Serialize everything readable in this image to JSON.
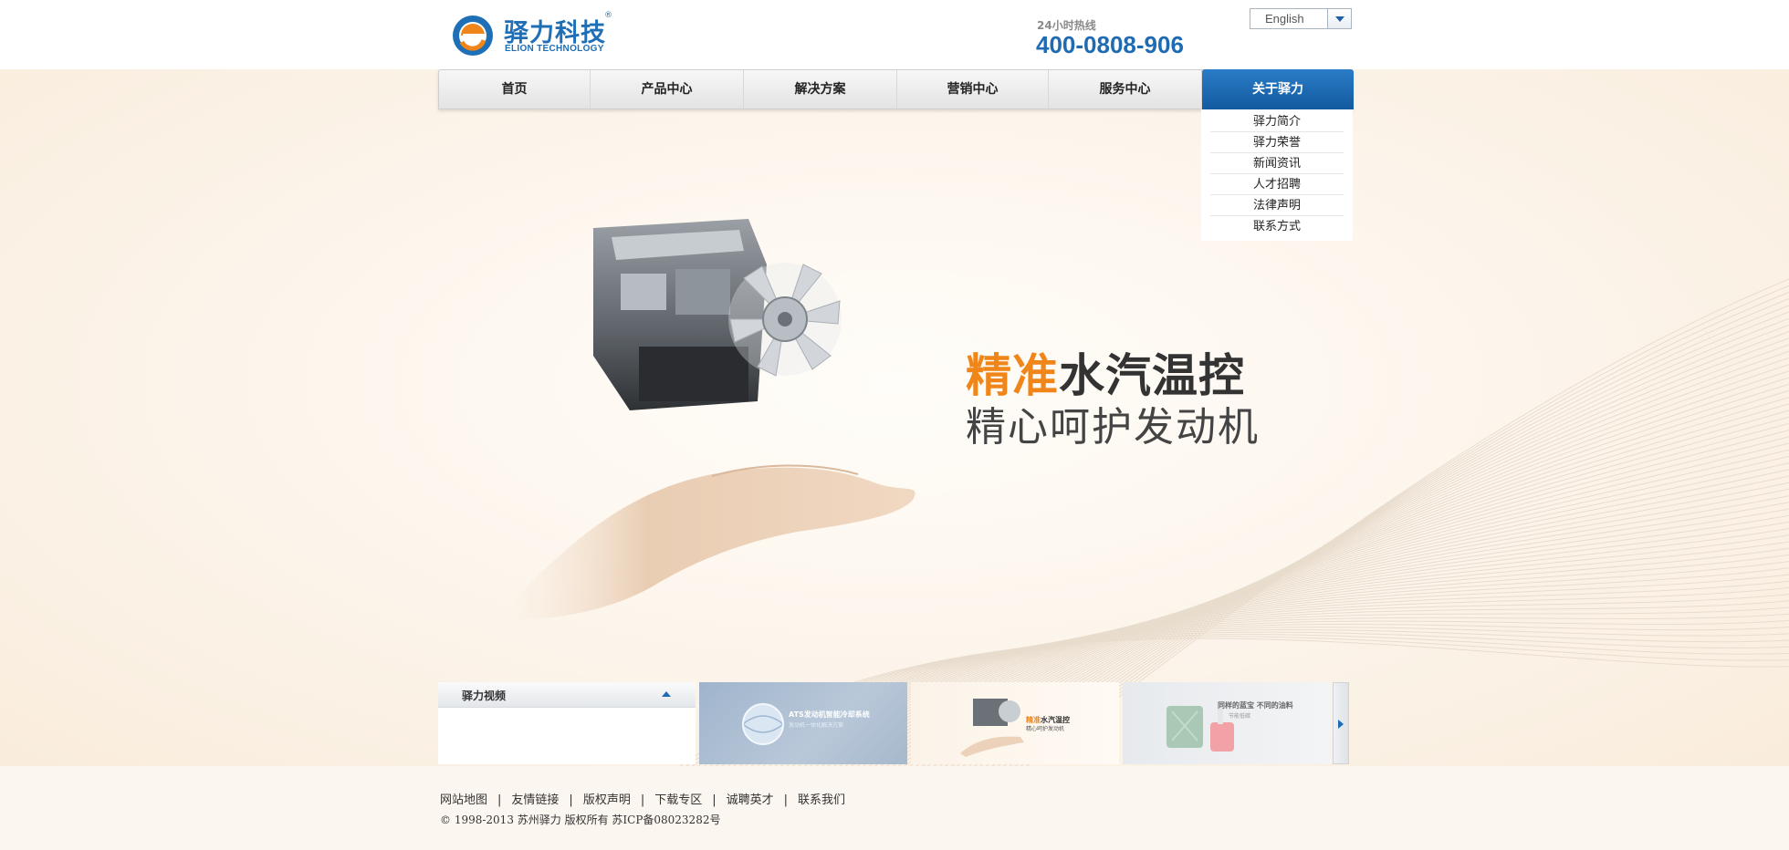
{
  "header": {
    "logo_cn": "驿力科技",
    "logo_en": "ELION TECHNOLOGY",
    "logo_reg": "®",
    "hotline_label": "24小时热线",
    "hotline_number": "400-0808-906",
    "language": "English"
  },
  "nav": {
    "items": [
      {
        "label": "首页"
      },
      {
        "label": "产品中心"
      },
      {
        "label": "解决方案"
      },
      {
        "label": "营销中心"
      },
      {
        "label": "服务中心"
      },
      {
        "label": "关于驿力"
      }
    ],
    "active_index": 5
  },
  "dropdown": {
    "items": [
      {
        "label": "驿力简介"
      },
      {
        "label": "驿力荣誉"
      },
      {
        "label": "新闻资讯"
      },
      {
        "label": "人才招聘"
      },
      {
        "label": "法律声明"
      },
      {
        "label": "联系方式"
      }
    ]
  },
  "hero": {
    "slogan_accent": "精准",
    "slogan_rest": "水汽温控",
    "slogan_line2": "精心呵护发动机"
  },
  "video_panel": {
    "title": "驿力视频"
  },
  "thumbnails": [
    {
      "caption": "ATS发动机智能冷却系统",
      "sub": "发动机一体化解决方案"
    },
    {
      "caption_accent": "精准",
      "caption": "水汽温控",
      "sub": "精心呵护发动机"
    },
    {
      "caption": "同样的蓝宝 不同的油料",
      "sub": "节能低碳"
    }
  ],
  "footer": {
    "links": [
      {
        "label": "网站地图"
      },
      {
        "label": "友情链接"
      },
      {
        "label": "版权声明"
      },
      {
        "label": "下载专区"
      },
      {
        "label": "诚聘英才"
      },
      {
        "label": "联系我们"
      }
    ],
    "separator": "|",
    "copyright": "© 1998-2013 苏州驿力 版权所有 苏ICP备08023282号"
  },
  "colors": {
    "brand_blue": "#1e6bb4",
    "accent_orange": "#f08519",
    "background": "#fbf3e8"
  }
}
